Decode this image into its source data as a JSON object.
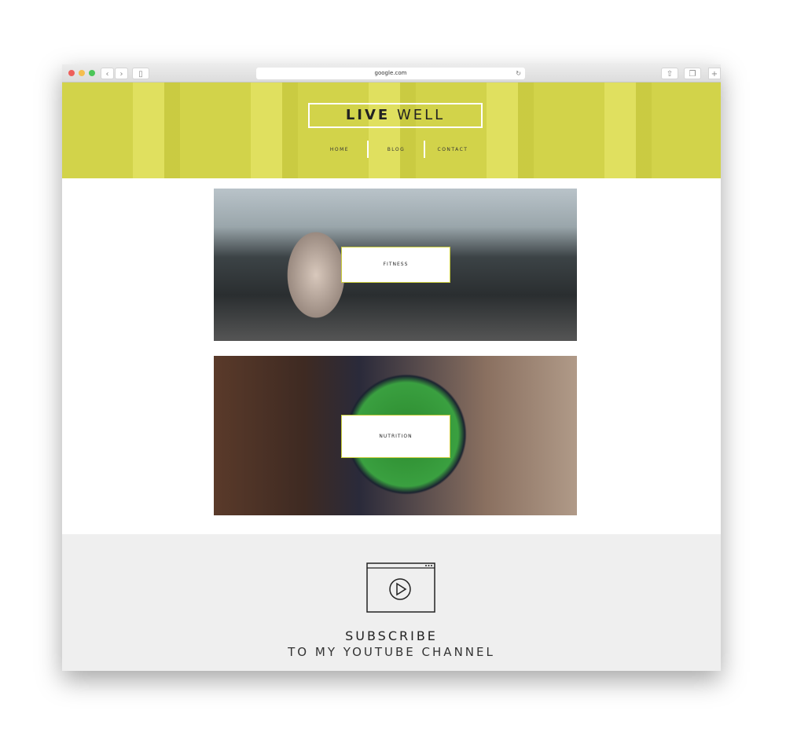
{
  "browser": {
    "url": "google.com",
    "colors": {
      "close": "#ee5f5b",
      "min": "#f5be4f",
      "max": "#4bc558"
    }
  },
  "header": {
    "logo_bold": "LIVE",
    "logo_light": "WELL",
    "bg": "#d2d34a",
    "nav": [
      {
        "label": "HOME"
      },
      {
        "label": "BLOG"
      },
      {
        "label": "CONTACT"
      }
    ]
  },
  "cards": [
    {
      "label": "FITNESS"
    },
    {
      "label": "NUTRITION"
    }
  ],
  "subscribe": {
    "title": "SUBSCRIBE",
    "subtitle": "TO MY YOUTUBE CHANNEL",
    "icon": "video-play-icon"
  }
}
